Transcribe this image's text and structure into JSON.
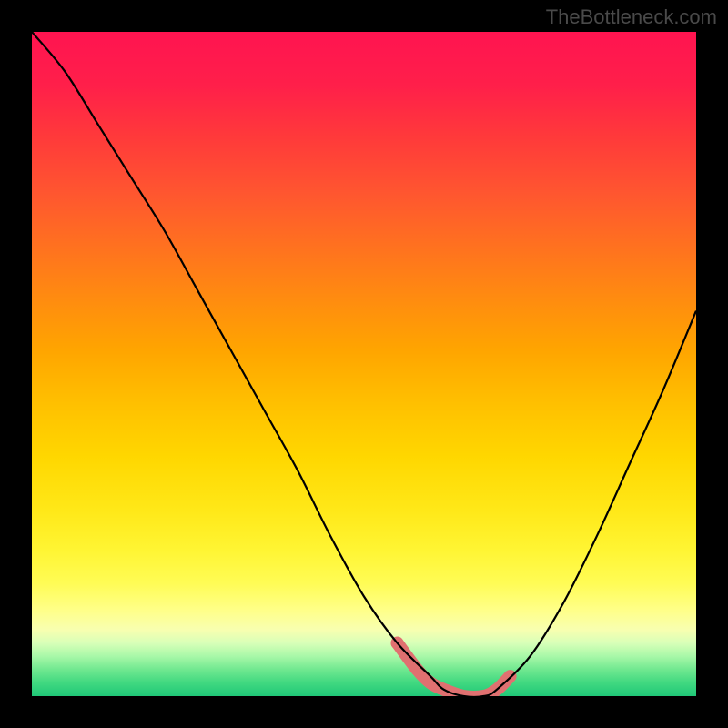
{
  "watermark": "TheBottleneck.com",
  "chart_data": {
    "type": "line",
    "title": "",
    "xlabel": "",
    "ylabel": "",
    "xlim": [
      0,
      100
    ],
    "ylim": [
      0,
      100
    ],
    "series": [
      {
        "name": "bottleneck-curve",
        "x": [
          0,
          5,
          10,
          15,
          20,
          25,
          30,
          35,
          40,
          45,
          50,
          55,
          60,
          62,
          65,
          68,
          70,
          75,
          80,
          85,
          90,
          95,
          100
        ],
        "y": [
          100,
          94,
          86,
          78,
          70,
          61,
          52,
          43,
          34,
          24,
          15,
          8,
          3,
          1,
          0,
          0,
          1,
          6,
          14,
          24,
          35,
          46,
          58
        ]
      },
      {
        "name": "optimal-range-highlight",
        "x": [
          55,
          58,
          60,
          62,
          65,
          68,
          70,
          72
        ],
        "y": [
          8,
          4,
          2,
          1,
          0,
          0,
          1,
          3
        ]
      }
    ],
    "background_gradient": {
      "top": "#ff1450",
      "mid": "#ffe818",
      "bottom": "#20c878"
    }
  }
}
